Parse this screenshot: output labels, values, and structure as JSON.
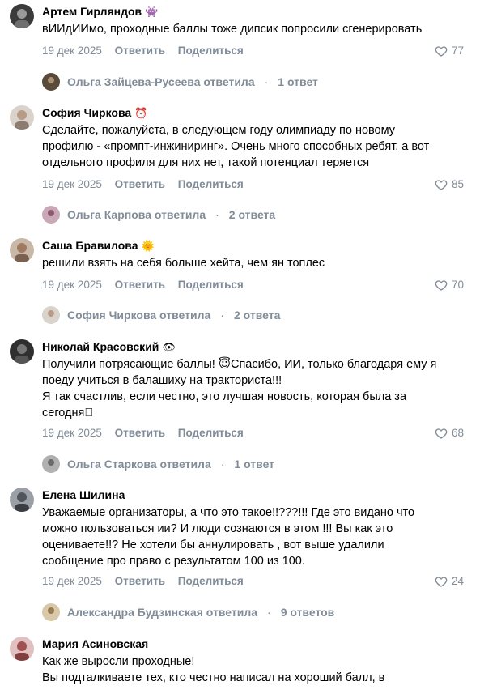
{
  "comments": [
    {
      "author": "Артем Гирляндов",
      "badge": "👾",
      "text": "вИИдИИмо, проходные баллы тоже дипсик попросили сгенерировать",
      "date": "19 дек 2025",
      "reply_label": "Ответить",
      "share_label": "Поделиться",
      "likes": "77",
      "thread": {
        "name": "Ольга Зайцева-Русеева",
        "verb": "ответила",
        "count": "1 ответ"
      }
    },
    {
      "author": "София Чиркова",
      "badge": "⏰",
      "text": "Сделайте, пожалуйста, в следующем году олимпиаду по новому\nпрофилю - «промпт-инжиниринг». Очень много способных ребят, а вот\nотдельного профиля для них нет, такой потенциал теряется",
      "date": "19 дек 2025",
      "reply_label": "Ответить",
      "share_label": "Поделиться",
      "likes": "85",
      "thread": {
        "name": "Ольга Карпова",
        "verb": "ответила",
        "count": "2 ответа"
      }
    },
    {
      "author": "Саша Бравилова",
      "badge": "🌞",
      "text": "решили взять на себя больше хейта, чем ян топлес",
      "date": "19 дек 2025",
      "reply_label": "Ответить",
      "share_label": "Поделиться",
      "likes": "70",
      "thread": {
        "name": "София Чиркова",
        "verb": "ответила",
        "count": "2 ответа"
      }
    },
    {
      "author": "Николай Красовский",
      "badge": "👁",
      "text": "Получили потрясающие баллы! 😇Спасибо, ИИ, только благодаря ему я\nпоеду учиться в балашиху на тракториста!!!\nЯ так счастлив, если честно, это лучшая новость, которая была за\nсегодня⃞",
      "date": "19 дек 2025",
      "reply_label": "Ответить",
      "share_label": "Поделиться",
      "likes": "68",
      "thread": {
        "name": "Ольга Старкова",
        "verb": "ответила",
        "count": "1 ответ"
      }
    },
    {
      "author": "Елена Шилина",
      "badge": "",
      "text": "Уважаемые организаторы, а что это такое!!???!!! Где это видано что\nможно пользоваться ии? И люди сознаются в этом !!! Вы как это\nоцениваете!!? Не хотели бы аннулировать , вот выше удалили\nсообщение про право с результатом 100 из 100.",
      "date": "19 дек 2025",
      "reply_label": "Ответить",
      "share_label": "Поделиться",
      "likes": "24",
      "thread": {
        "name": "Александра Будзинская",
        "verb": "ответила",
        "count": "9 ответов"
      }
    },
    {
      "author": "Мария Асиновская",
      "badge": "",
      "text": "Как же выросли проходные!\nВы подталкиваете тех, кто честно написал на хороший балл, в",
      "date": "",
      "reply_label": "",
      "share_label": "",
      "likes": "",
      "thread": null
    }
  ]
}
